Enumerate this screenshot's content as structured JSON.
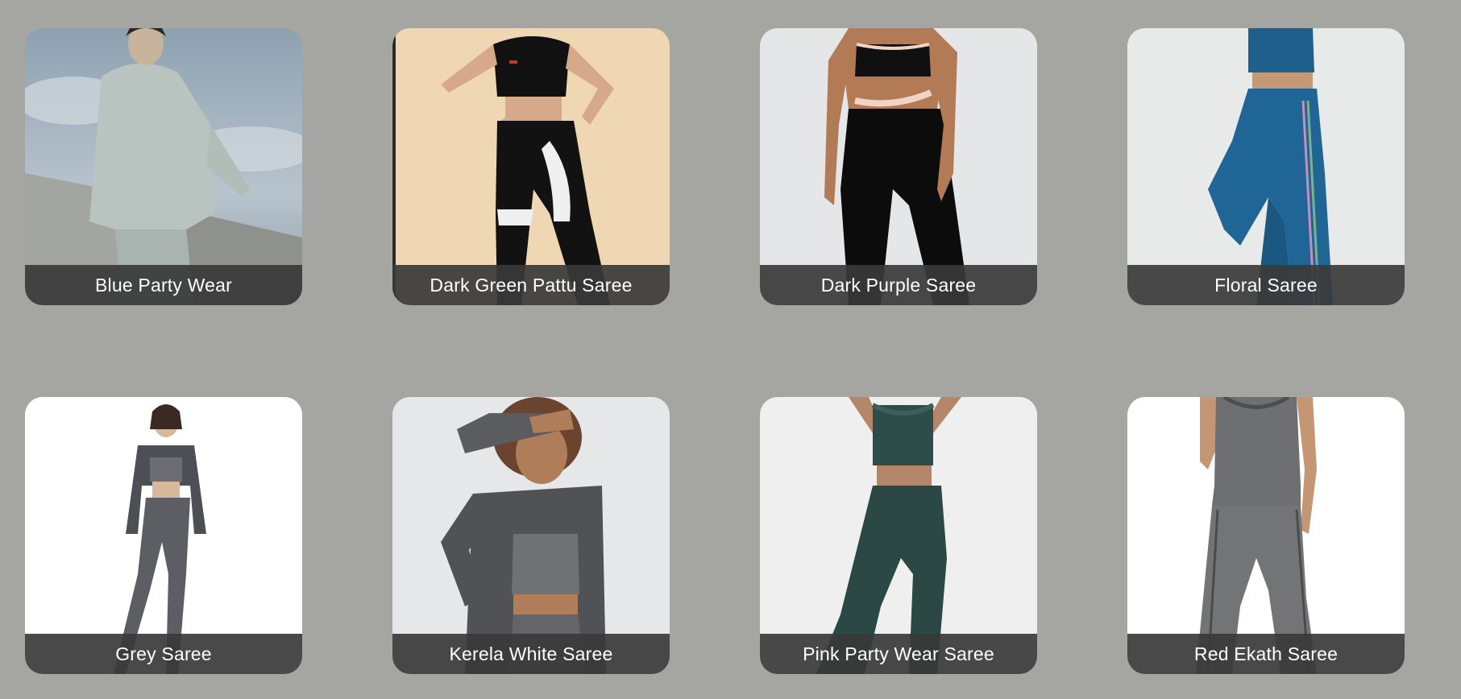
{
  "products": [
    {
      "name": "Blue Party Wear",
      "image": "model in light grey hooded tracksuit, cloudy sky",
      "bg": "#9fb0bd"
    },
    {
      "name": "Dark Green Pattu Saree",
      "image": "model in black crop top and black-white leggings",
      "bg": "#f1d9b6"
    },
    {
      "name": "Dark Purple Saree",
      "image": "model in black and peach strappy activewear",
      "bg": "#e7e8e8"
    },
    {
      "name": "Floral Saree",
      "image": "model in teal blue sports bra and leggings",
      "bg": "#e9eaea"
    },
    {
      "name": "Grey Saree",
      "image": "model in grey zip jacket and grey leggings",
      "bg": "#ffffff"
    },
    {
      "name": "Kerela White Saree",
      "image": "model in charcoal zip jacket and sports bra",
      "bg": "#e6e7e9"
    },
    {
      "name": "Pink Party Wear Saree",
      "image": "model in dark green crop top and leggings",
      "bg": "#efefef"
    },
    {
      "name": "Red Ekath Saree",
      "image": "model in grey marled tank and leggings",
      "bg": "#ffffff"
    }
  ]
}
